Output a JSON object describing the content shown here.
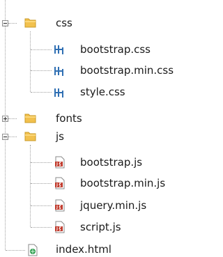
{
  "tree": {
    "items": [
      {
        "label": "css",
        "icon": "folder-icon",
        "expanded": true
      },
      {
        "label": "bootstrap.css",
        "icon": "css-file-icon"
      },
      {
        "label": "bootstrap.min.css",
        "icon": "css-file-icon"
      },
      {
        "label": "style.css",
        "icon": "css-file-icon"
      },
      {
        "label": "fonts",
        "icon": "folder-icon",
        "expanded": false
      },
      {
        "label": "js",
        "icon": "folder-icon",
        "expanded": true
      },
      {
        "label": "bootstrap.js",
        "icon": "js-file-icon"
      },
      {
        "label": "bootstrap.min.js",
        "icon": "js-file-icon"
      },
      {
        "label": "jquery.min.js",
        "icon": "js-file-icon"
      },
      {
        "label": "script.js",
        "icon": "js-file-icon"
      },
      {
        "label": "index.html",
        "icon": "html-file-icon"
      }
    ]
  },
  "colors": {
    "folder": "#f2c14e",
    "js_badge": "#c0392b",
    "css_icon": "#2f6fb3",
    "html_icon": "#2e9d4f",
    "guide": "#a0a0a0",
    "text": "#1a1a1a"
  }
}
